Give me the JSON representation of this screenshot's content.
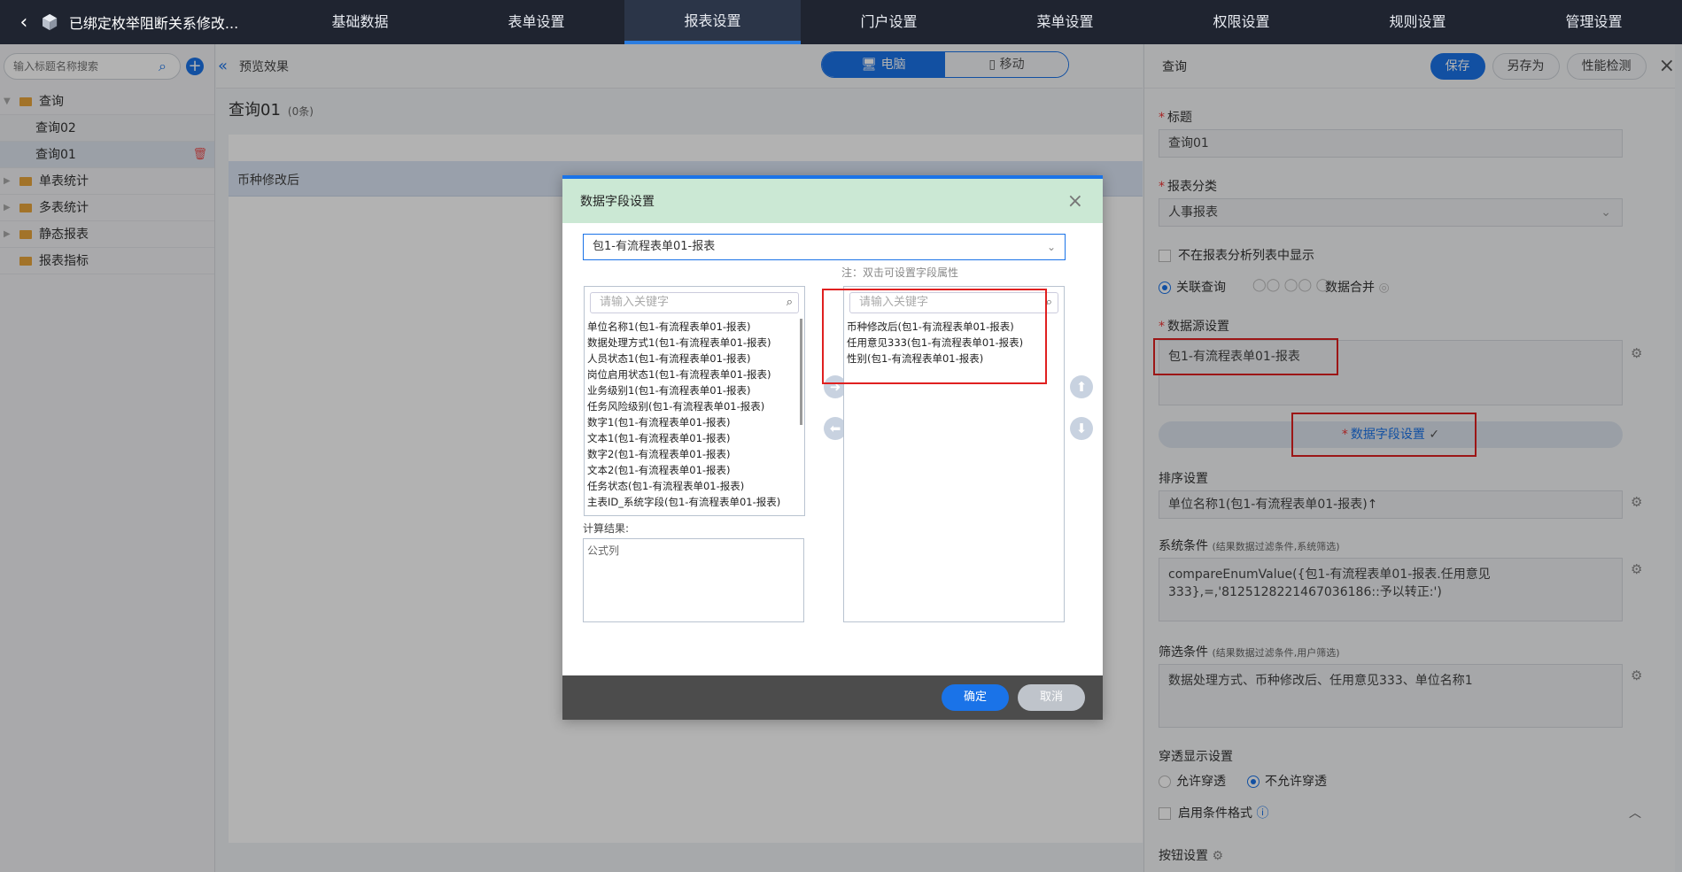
{
  "app": {
    "title": "已绑定枚举阻断关系修改...",
    "nav": [
      "基础数据",
      "表单设置",
      "报表设置",
      "门户设置",
      "菜单设置",
      "权限设置",
      "规则设置",
      "管理设置"
    ],
    "active_nav": "报表设置"
  },
  "sidebar": {
    "search_placeholder": "输入标题名称搜索",
    "items": [
      {
        "label": "查询",
        "level": 0,
        "expanded": true
      },
      {
        "label": "查询02",
        "level": 1
      },
      {
        "label": "查询01",
        "level": 1,
        "selected": true
      },
      {
        "label": "单表统计",
        "level": 0
      },
      {
        "label": "多表统计",
        "level": 0
      },
      {
        "label": "静态报表",
        "level": 0
      },
      {
        "label": "报表指标",
        "level": 0
      }
    ]
  },
  "preview": {
    "header": "预览效果",
    "mode_pc": "电脑",
    "mode_mobile": "移动",
    "query_title": "查询01",
    "count": "(0条)",
    "column1": "币种修改后"
  },
  "panel": {
    "title": "查询",
    "save": "保存",
    "save_as": "另存为",
    "perf_check": "性能检测",
    "label_title": "标题",
    "title_value": "查询01",
    "label_category": "报表分类",
    "category_value": "人事报表",
    "hide_in_list": "不在报表分析列表中显示",
    "linked_query": "关联查询",
    "data_merge": "数据合并",
    "label_datasource": "数据源设置",
    "datasource_value": "包1-有流程表单01-报表",
    "field_settings": "数据字段设置",
    "label_sort": "排序设置",
    "sort_value": "单位名称1(包1-有流程表单01-报表)↑",
    "label_system_cond": "系统条件",
    "system_cond_note": "(结果数据过滤条件,系统筛选)",
    "system_cond_value": "compareEnumValue({包1-有流程表单01-报表.任用意见333},=,'8125128221467036186::予以转正:')",
    "label_filter_cond": "筛选条件",
    "filter_cond_note": "(结果数据过滤条件,用户筛选)",
    "filter_cond_value": "数据处理方式、币种修改后、任用意见333、单位名称1",
    "label_drill": "穿透显示设置",
    "allow_drill": "允许穿透",
    "deny_drill": "不允许穿透",
    "enable_cond_format": "启用条件格式",
    "label_buttons": "按钮设置"
  },
  "modal": {
    "title": "数据字段设置",
    "table_select": "包1-有流程表单01-报表",
    "note": "注：双击可设置字段属性",
    "keyword_placeholder": "请输入关键字",
    "available_fields": [
      "单位名称1(包1-有流程表单01-报表)",
      "数据处理方式1(包1-有流程表单01-报表)",
      "人员状态1(包1-有流程表单01-报表)",
      "岗位启用状态1(包1-有流程表单01-报表)",
      "业务级别1(包1-有流程表单01-报表)",
      "任务风险级别(包1-有流程表单01-报表)",
      "数字1(包1-有流程表单01-报表)",
      "文本1(包1-有流程表单01-报表)",
      "数字2(包1-有流程表单01-报表)",
      "文本2(包1-有流程表单01-报表)",
      "任务状态(包1-有流程表单01-报表)",
      "主表ID_系统字段(包1-有流程表单01-报表)"
    ],
    "selected_fields": [
      "币种修改后(包1-有流程表单01-报表)",
      "任用意见333(包1-有流程表单01-报表)",
      "性别(包1-有流程表单01-报表)"
    ],
    "calc_label": "计算结果:",
    "calc_item": "公式列",
    "ok": "确定",
    "cancel": "取消"
  }
}
